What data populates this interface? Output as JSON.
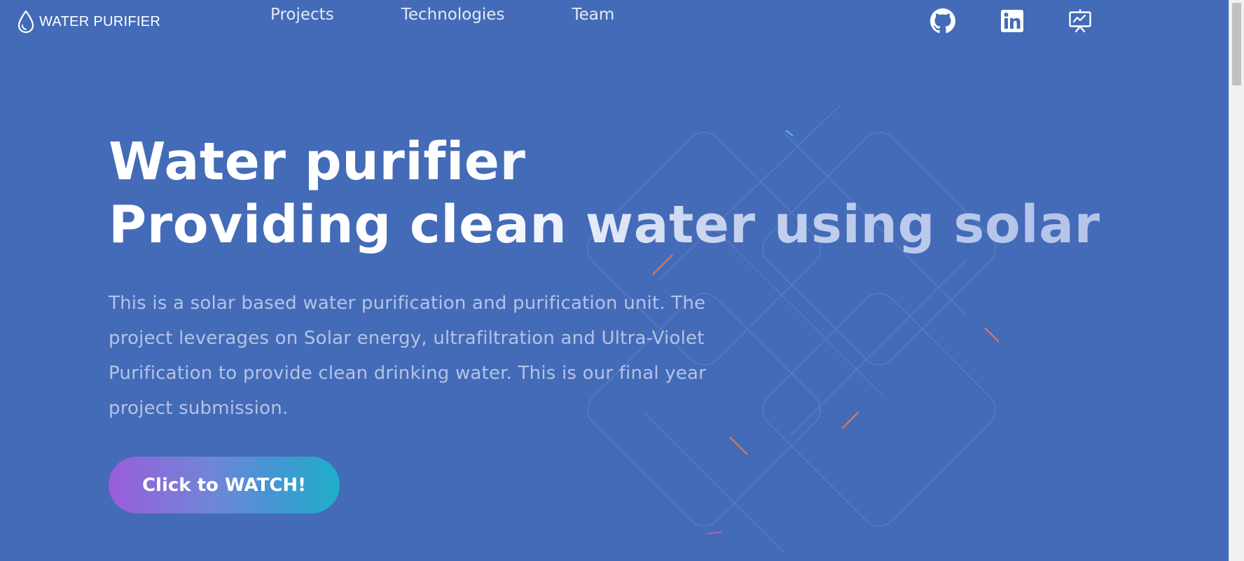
{
  "brand": {
    "logo_text": "WATER PURIFIER",
    "logo_icon": "water-drop-icon"
  },
  "nav": {
    "links": [
      {
        "label": "Projects"
      },
      {
        "label": "Technologies"
      },
      {
        "label": "Team"
      }
    ],
    "social": [
      {
        "icon": "github-icon"
      },
      {
        "icon": "linkedin-icon"
      },
      {
        "icon": "presentation-icon"
      }
    ]
  },
  "hero": {
    "title_line1": "Water purifier",
    "title_line2": "Providing clean water using solar",
    "description": "This is a solar based water purification and purification unit. The project leverages on Solar energy, ultrafiltration and Ultra-Violet Purification to provide clean drinking water. This is our final year project submission.",
    "cta_label": "Click to WATCH!"
  },
  "colors": {
    "background": "#446bb7",
    "description_text": "#b4c3e6",
    "cta_gradient_start": "#9a5ddc",
    "cta_gradient_end": "#1eaec9",
    "scrollbar_track": "#f1f1f1",
    "scrollbar_thumb": "#c1c1c1"
  }
}
